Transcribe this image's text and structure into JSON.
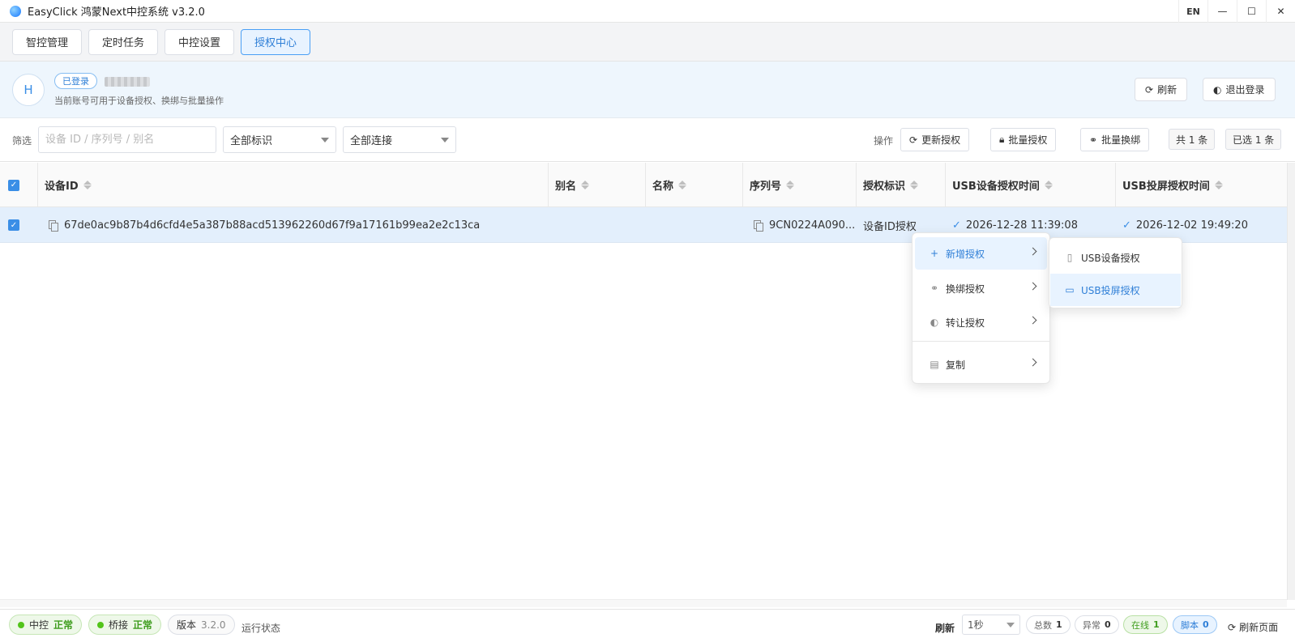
{
  "window": {
    "title": "EasyClick 鸿蒙Next中控系统 v3.2.0",
    "lang": "EN",
    "minimize": "—",
    "maximize": "☐",
    "close": "✕"
  },
  "tabs": [
    {
      "label": "智控管理"
    },
    {
      "label": "定时任务"
    },
    {
      "label": "中控设置"
    },
    {
      "label": "授权中心",
      "active": true
    }
  ],
  "account": {
    "avatar": "H",
    "badge": "已登录",
    "description": "当前账号可用于设备授权、换绑与批量操作",
    "refresh_label": "刷新",
    "logout_label": "退出登录"
  },
  "filter": {
    "label": "筛选",
    "search_placeholder": "设备 ID / 序列号 / 别名",
    "tag_select": "全部标识",
    "conn_select": "全部连接",
    "ops_label": "操作",
    "update_label": "更新授权",
    "batch_auth_label": "批量授权",
    "batch_rebind_label": "批量换绑",
    "total": "共 1 条",
    "selected": "已选 1 条"
  },
  "table": {
    "headers": {
      "device_id": "设备ID",
      "alias": "别名",
      "name": "名称",
      "serial": "序列号",
      "auth_tag": "授权标识",
      "usb_device_time": "USB设备授权时间",
      "usb_screen_time": "USB投屏授权时间"
    },
    "rows": [
      {
        "device_id": "67de0ac9b87b4d6cfd4e5a387b88acd513962260d67f9a17161b99ea2e2c13ca",
        "alias": "",
        "name": "",
        "serial": "9CN0224A090...",
        "auth_tag": "设备ID授权",
        "usb_device_time": "2026-12-28 11:39:08",
        "usb_screen_time": "2026-12-02 19:49:20"
      }
    ]
  },
  "context_menu": {
    "items": [
      {
        "label": "新增授权",
        "icon": "plus-icon",
        "active": true
      },
      {
        "label": "换绑授权",
        "icon": "link-icon"
      },
      {
        "label": "转让授权",
        "icon": "transfer-icon"
      },
      {
        "label": "复制",
        "icon": "copy-icon"
      }
    ],
    "submenu": [
      {
        "label": "USB设备授权",
        "icon": "phone-icon"
      },
      {
        "label": "USB投屏授权",
        "icon": "monitor-icon",
        "active": true
      }
    ]
  },
  "status": {
    "control_label": "中控",
    "control_state": "正常",
    "bridge_label": "桥接",
    "bridge_state": "正常",
    "version_label": "版本",
    "version_value": "3.2.0",
    "run_status": "运行状态",
    "refresh_label": "刷新",
    "refresh_interval": "1秒",
    "total_label": "总数",
    "total_value": "1",
    "error_label": "异常",
    "error_value": "0",
    "online_label": "在线",
    "online_value": "1",
    "script_label": "脚本",
    "script_value": "0",
    "refresh_page": "刷新页面"
  },
  "colors": {
    "accent": "#2f7fd7",
    "ok": "#3f9d1e",
    "row_selected": "#e3effc"
  }
}
